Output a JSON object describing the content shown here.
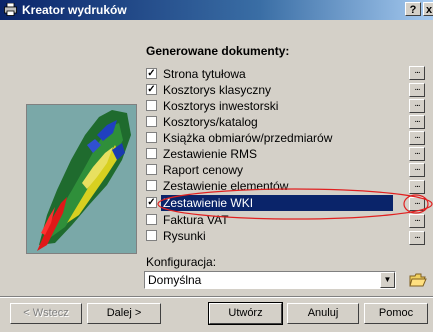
{
  "window": {
    "title": "Kreator wydruków"
  },
  "titlebar_buttons": {
    "help": "?",
    "close": "x"
  },
  "section": {
    "title": "Generowane dokumenty:"
  },
  "documents": [
    {
      "label": "Strona tytułowa",
      "checked": true,
      "selected": false
    },
    {
      "label": "Kosztorys klasyczny",
      "checked": true,
      "selected": false
    },
    {
      "label": "Kosztorys inwestorski",
      "checked": false,
      "selected": false
    },
    {
      "label": "Kosztorys/katalog",
      "checked": false,
      "selected": false
    },
    {
      "label": "Książka obmiarów/przedmiarów",
      "checked": false,
      "selected": false
    },
    {
      "label": "Zestawienie RMS",
      "checked": false,
      "selected": false
    },
    {
      "label": "Raport cenowy",
      "checked": false,
      "selected": false
    },
    {
      "label": "Zestawienie elementów",
      "checked": false,
      "selected": false
    },
    {
      "label": "Zestawienie WKI",
      "checked": true,
      "selected": true
    },
    {
      "label": "Faktura VAT",
      "checked": false,
      "selected": false
    },
    {
      "label": "Rysunki",
      "checked": false,
      "selected": false
    }
  ],
  "options_button_label": "...",
  "configuration": {
    "label": "Konfiguracja:",
    "value": "Domyślna"
  },
  "buttons": {
    "back": "< Wstecz",
    "next": "Dalej >",
    "create": "Utwórz",
    "cancel": "Anuluj",
    "help": "Pomoc"
  },
  "colors": {
    "selection": "#0a246a",
    "annotation": "#e02020",
    "window_bg": "#d4d0c8"
  }
}
